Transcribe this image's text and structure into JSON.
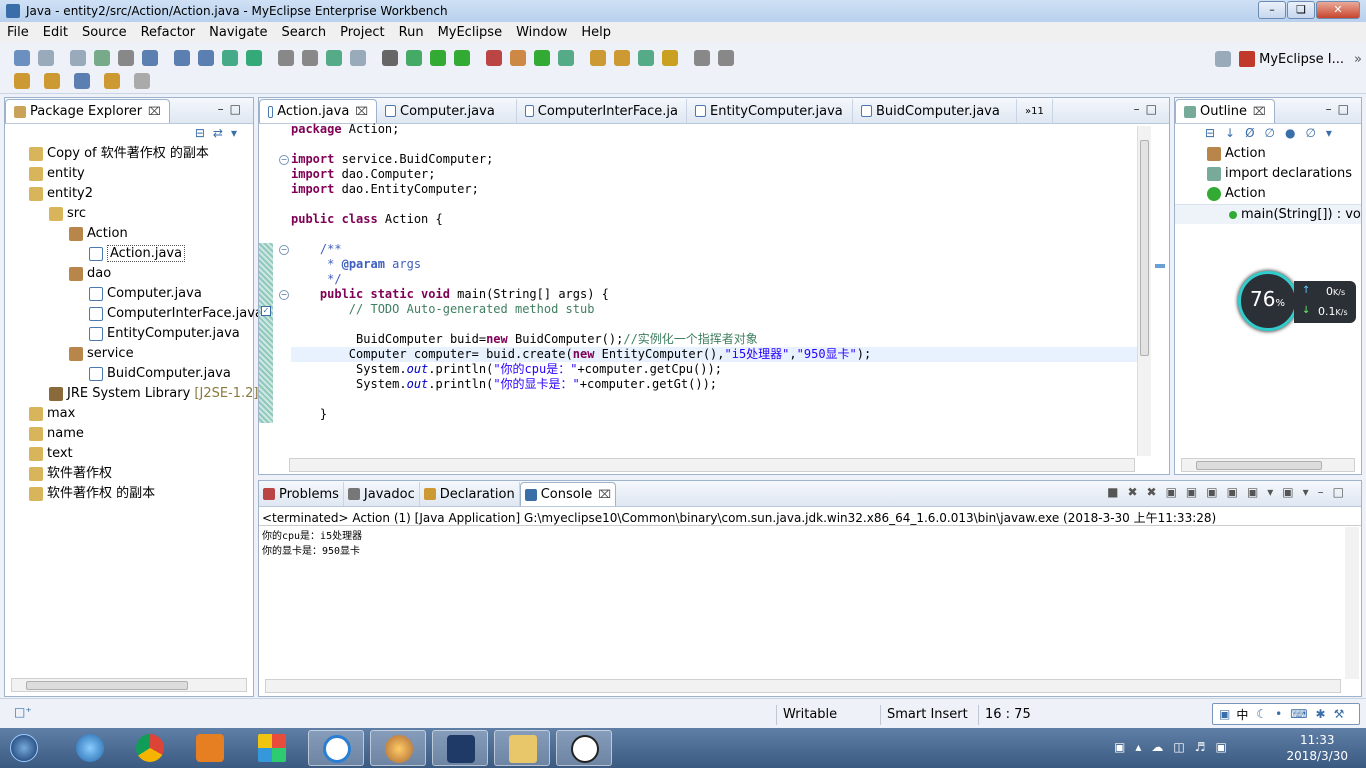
{
  "window": {
    "title": "Java - entity2/src/Action/Action.java - MyEclipse Enterprise Workbench"
  },
  "menu": [
    "File",
    "Edit",
    "Source",
    "Refactor",
    "Navigate",
    "Search",
    "Project",
    "Run",
    "MyEclipse",
    "Window",
    "Help"
  ],
  "perspective": {
    "label": "MyEclipse I..."
  },
  "package_explorer": {
    "title": "Package Explorer",
    "items": [
      {
        "label": "Copy of 软件著作权 的副本",
        "indent": 0,
        "icon": "folder-icon"
      },
      {
        "label": "entity",
        "indent": 0,
        "icon": "folder-icon"
      },
      {
        "label": "entity2",
        "indent": 0,
        "icon": "folder-icon"
      },
      {
        "label": "src",
        "indent": 1,
        "icon": "folder-icon"
      },
      {
        "label": "Action",
        "indent": 2,
        "icon": "package-icon"
      },
      {
        "label": "Action.java",
        "indent": 3,
        "icon": "java-file-icon",
        "selected": true
      },
      {
        "label": "dao",
        "indent": 2,
        "icon": "package-icon"
      },
      {
        "label": "Computer.java",
        "indent": 3,
        "icon": "java-file-icon"
      },
      {
        "label": "ComputerInterFace.java",
        "indent": 3,
        "icon": "java-file-icon"
      },
      {
        "label": "EntityComputer.java",
        "indent": 3,
        "icon": "java-file-icon"
      },
      {
        "label": "service",
        "indent": 2,
        "icon": "package-icon"
      },
      {
        "label": "BuidComputer.java",
        "indent": 3,
        "icon": "java-file-icon"
      },
      {
        "label": "JRE System Library",
        "suffix": "[J2SE-1.2]",
        "indent": 1,
        "icon": "library-icon"
      },
      {
        "label": "max",
        "indent": 0,
        "icon": "folder-icon"
      },
      {
        "label": "name",
        "indent": 0,
        "icon": "folder-icon"
      },
      {
        "label": "text",
        "indent": 0,
        "icon": "folder-icon"
      },
      {
        "label": "软件著作权",
        "indent": 0,
        "icon": "folder-icon"
      },
      {
        "label": "软件著作权 的副本",
        "indent": 0,
        "icon": "folder-icon"
      }
    ]
  },
  "editor": {
    "tabs": [
      {
        "label": "Action.java",
        "active": true
      },
      {
        "label": "Computer.java"
      },
      {
        "label": "ComputerInterFace.ja"
      },
      {
        "label": "EntityComputer.java"
      },
      {
        "label": "BuidComputer.java"
      }
    ],
    "overflow": "»11",
    "lines": [
      "<span class='kw'>package</span> Action;",
      "",
      "<span class='kw'>import</span> service.BuidComputer;",
      "<span class='kw'>import</span> dao.Computer;",
      "<span class='kw'>import</span> dao.EntityComputer;",
      "",
      "<span class='kw'>public class</span> Action {",
      "",
      "    <span class='jd'>/**</span>",
      "    <span class='jd'> * <b>@param</b> args</span>",
      "    <span class='jd'> */</span>",
      "    <span class='kw'>public static void</span> main(String[] args) {",
      "        <span class='cm'>// TODO Auto-generated method stub</span>",
      "",
      "         BuidComputer buid=<span class='kw'>new</span> BuidComputer();<span class='cm'>//实例化一个指挥者对象</span>",
      "        Computer computer= buid.create(<span class='kw'>new</span> EntityComputer(),<span class='st'>\"i5处理器\"</span>,<span class='st'>\"950显卡\"</span>);",
      "         System.<span class='it'>out</span>.println(<span class='st'>\"你的cpu是：\"</span>+computer.getCpu());",
      "         System.<span class='it'>out</span>.println(<span class='st'>\"你的显卡是：\"</span>+computer.getGt());",
      "",
      "    }"
    ]
  },
  "outline": {
    "title": "Outline",
    "items": [
      {
        "label": "Action",
        "indent": 0,
        "icon": "package-icon"
      },
      {
        "label": "import declarations",
        "indent": 0,
        "icon": "imports-icon"
      },
      {
        "label": "Action",
        "indent": 0,
        "icon": "class-icon"
      },
      {
        "label": "main(String[]) : vo",
        "indent": 1,
        "icon": "method-icon",
        "selected": true
      }
    ]
  },
  "net_gauge": {
    "percent": "76",
    "percent_unit": "%",
    "up": "0",
    "down": "0.1",
    "unit": "K/s"
  },
  "bottom_panel": {
    "tabs": [
      {
        "label": "Problems",
        "icon": "problems-icon"
      },
      {
        "label": "Javadoc",
        "icon": "at-icon"
      },
      {
        "label": "Declaration",
        "icon": "declaration-icon"
      },
      {
        "label": "Console",
        "icon": "console-icon",
        "active": true
      }
    ],
    "console_header": "<terminated> Action (1) [Java Application] G:\\myeclipse10\\Common\\binary\\com.sun.java.jdk.win32.x86_64_1.6.0.013\\bin\\javaw.exe (2018-3-30 上午11:33:28)",
    "output": [
      "你的cpu是：i5处理器",
      "你的显卡是：950显卡"
    ]
  },
  "status": {
    "writable": "Writable",
    "insert_mode": "Smart Insert",
    "position": "16 : 75"
  },
  "taskbar": {
    "time": "11:33",
    "date": "2018/3/30",
    "ime": "中"
  }
}
